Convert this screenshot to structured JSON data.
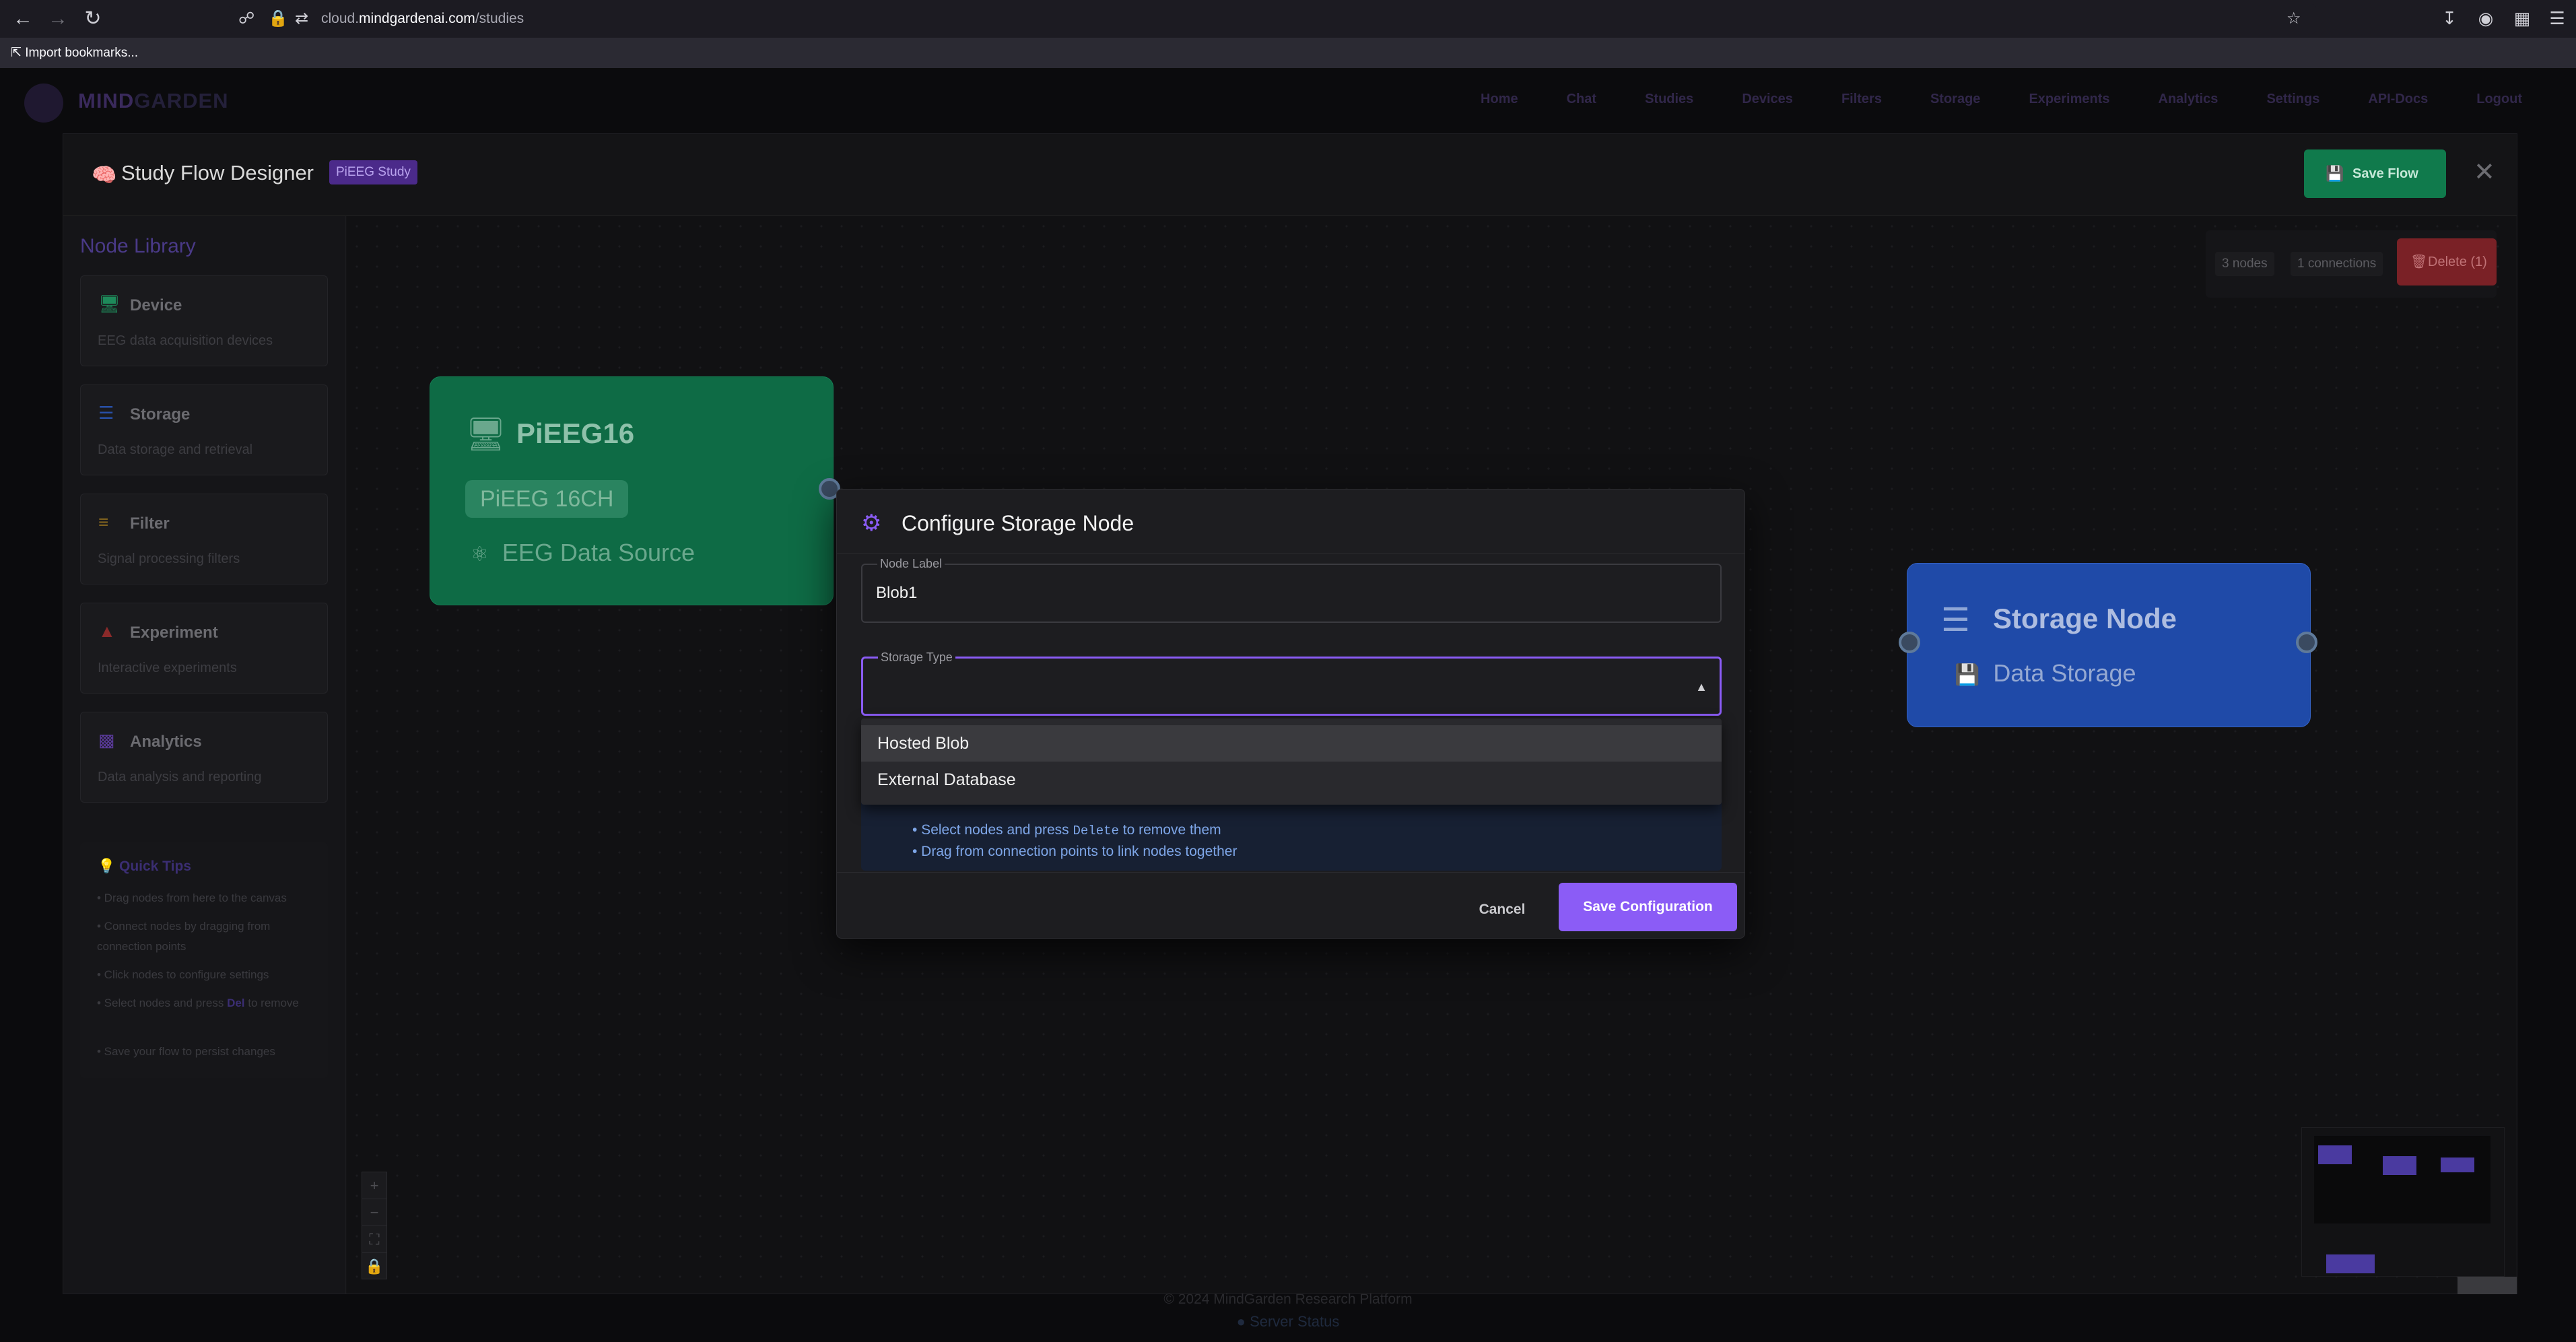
{
  "browser": {
    "url_prefix": "cloud.",
    "url_host": "mindgardenai.com",
    "url_path": "/studies",
    "bookmarks_label": "Import bookmarks..."
  },
  "app": {
    "brand_part1": "MIND",
    "brand_part2": "GARDEN",
    "nav": [
      "Home",
      "Chat",
      "Studies",
      "Devices",
      "Filters",
      "Storage",
      "Experiments",
      "Analytics",
      "Settings",
      "API-Docs",
      "Logout"
    ]
  },
  "designer": {
    "title": "Study Flow Designer",
    "badge": "PiEEG Study",
    "save_flow_label": "Save Flow",
    "nodes_count": "3 nodes",
    "connections_count": "1 connections",
    "delete_label": "Delete (1)"
  },
  "sidebar": {
    "title": "Node Library",
    "items": [
      {
        "label": "Device",
        "desc": "EEG data acquisition devices",
        "icon": "device-icon",
        "color": "#1e8a5a"
      },
      {
        "label": "Storage",
        "desc": "Data storage and retrieval",
        "icon": "storage-icon",
        "color": "#2850a8"
      },
      {
        "label": "Filter",
        "desc": "Signal processing filters",
        "icon": "filter-icon",
        "color": "#8a6a1e"
      },
      {
        "label": "Experiment",
        "desc": "Interactive experiments",
        "icon": "flask-icon",
        "color": "#8a2a2a"
      },
      {
        "label": "Analytics",
        "desc": "Data analysis and reporting",
        "icon": "chart-icon",
        "color": "#5a3a9a"
      }
    ],
    "tips_title": "Quick Tips",
    "tips": [
      "• Drag nodes from here to the canvas",
      "• Connect nodes by dragging from connection points",
      "• Click nodes to configure settings",
      "• Save your flow to persist changes"
    ],
    "tip_delete_pre": "• Select nodes and press ",
    "tip_delete_key": "Del",
    "tip_delete_post": " to remove"
  },
  "nodes": {
    "device": {
      "title": "PiEEG16",
      "chip": "PiEEG 16CH",
      "source": "EEG Data Source"
    },
    "storage": {
      "title": "Storage Node",
      "subtitle": "Data Storage"
    }
  },
  "modal": {
    "title": "Configure Storage Node",
    "node_label_label": "Node Label",
    "node_label_value": "Blob1",
    "storage_type_label": "Storage Type",
    "storage_type_value": "",
    "options": [
      "Hosted Blob",
      "External Database"
    ],
    "hint_line1_pre": "• Select nodes and press ",
    "hint_line1_key": "Delete",
    "hint_line1_post": " to remove them",
    "hint_line2": "• Drag from connection points to link nodes together",
    "cancel_label": "Cancel",
    "save_label": "Save Configuration"
  },
  "footer": {
    "copyright": "© 2024 MindGarden Research Platform",
    "server_status": "Server Status"
  },
  "colors": {
    "accent": "#8b5cf6",
    "device_node": "#0e6b45",
    "storage_node": "#1f4aa8",
    "save_flow": "#107a4c",
    "delete": "#7a2126"
  }
}
